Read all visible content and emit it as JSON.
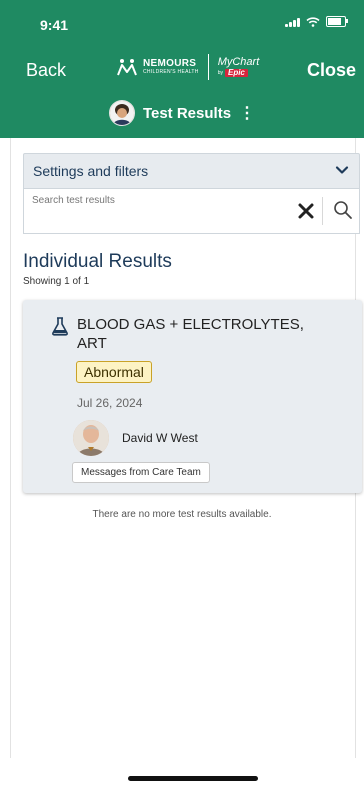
{
  "status_bar": {
    "time": "9:41"
  },
  "header": {
    "back_label": "Back",
    "close_label": "Close",
    "brand_name": "NEMOURS",
    "brand_sub": "CHILDREN'S HEALTH",
    "mychart_text": "MyChart",
    "mychart_by": "by",
    "epic_text": "Epic",
    "page_title": "Test Results",
    "menu_icon": "⋮"
  },
  "filters": {
    "label": "Settings and filters"
  },
  "search": {
    "placeholder": "Search test results",
    "value": ""
  },
  "results": {
    "section_title": "Individual Results",
    "showing": "Showing 1 of 1",
    "items": [
      {
        "title": "BLOOD GAS + ELECTROLYTES, ART",
        "status": "Abnormal",
        "date": "Jul 26, 2024",
        "provider": "David W West",
        "messages_label": "Messages from Care Team"
      }
    ],
    "end_message": "There are no more test results available."
  },
  "colors": {
    "header_bg": "#1f8a62",
    "accent_text": "#1e3b5a",
    "card_bg": "#e9edf1",
    "abnormal_bg": "#fdf3c4",
    "abnormal_border": "#c9a227",
    "epic_red": "#d7263d"
  },
  "icons": [
    "signal-icon",
    "wifi-icon",
    "battery-icon",
    "nemours-logo-icon",
    "chevron-down-icon",
    "clear-icon",
    "search-icon",
    "flask-icon",
    "avatar"
  ]
}
